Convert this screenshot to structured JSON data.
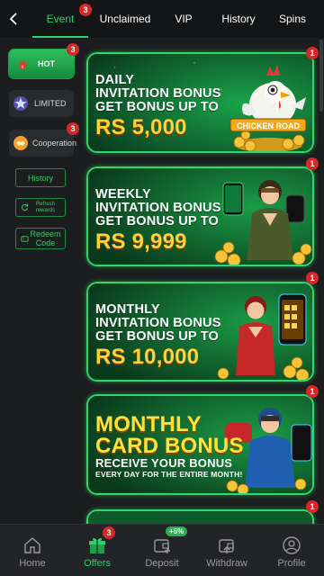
{
  "nav": {
    "tabs": [
      {
        "label": "Event",
        "badge": "3"
      },
      {
        "label": "Unclaimed"
      },
      {
        "label": "VIP"
      },
      {
        "label": "History"
      },
      {
        "label": "Spins"
      }
    ]
  },
  "sidebar": {
    "hot": {
      "label": "HOT",
      "badge": "3"
    },
    "limited": {
      "label": "LIMITED"
    },
    "cooperation": {
      "label": "Cooperation",
      "badge": "3"
    },
    "history": "History",
    "refresh": "Refresh rewards",
    "redeem": "Redeem Code"
  },
  "banners": [
    {
      "badge": "1",
      "line1": "DAILY",
      "line2": "INVITATION BONUS",
      "line3": "GET BONUS UP TO",
      "amount": "RS 5,000",
      "art_text": "CHICKEN ROAD"
    },
    {
      "badge": "1",
      "line1": "WEEKLY",
      "line2": "INVITATION BONUS",
      "line3": "GET BONUS UP TO",
      "amount": "RS 9,999"
    },
    {
      "badge": "1",
      "line1": "MONTHLY",
      "line2": "INVITATION BONUS",
      "line3": "GET BONUS UP TO",
      "amount": "RS 10,000"
    },
    {
      "badge": "1",
      "line1": "MONTHLY",
      "line2": "CARD BONUS",
      "line3": "RECEIVE YOUR BONUS",
      "line4": "EVERY DAY FOR THE ENTIRE MONTH!"
    },
    {
      "badge": "1"
    }
  ],
  "bottom_nav": [
    {
      "label": "Home",
      "icon": "home-icon"
    },
    {
      "label": "Offers",
      "icon": "gift-icon",
      "badge": "3"
    },
    {
      "label": "Deposit",
      "icon": "wallet-plus-icon",
      "pill": "+5%"
    },
    {
      "label": "Withdraw",
      "icon": "wallet-out-icon"
    },
    {
      "label": "Profile",
      "icon": "profile-icon"
    }
  ],
  "colors": {
    "accent": "#2ad36b",
    "badge": "#d62828",
    "gold": "#ffd13b",
    "background": "#1c1d1f"
  }
}
